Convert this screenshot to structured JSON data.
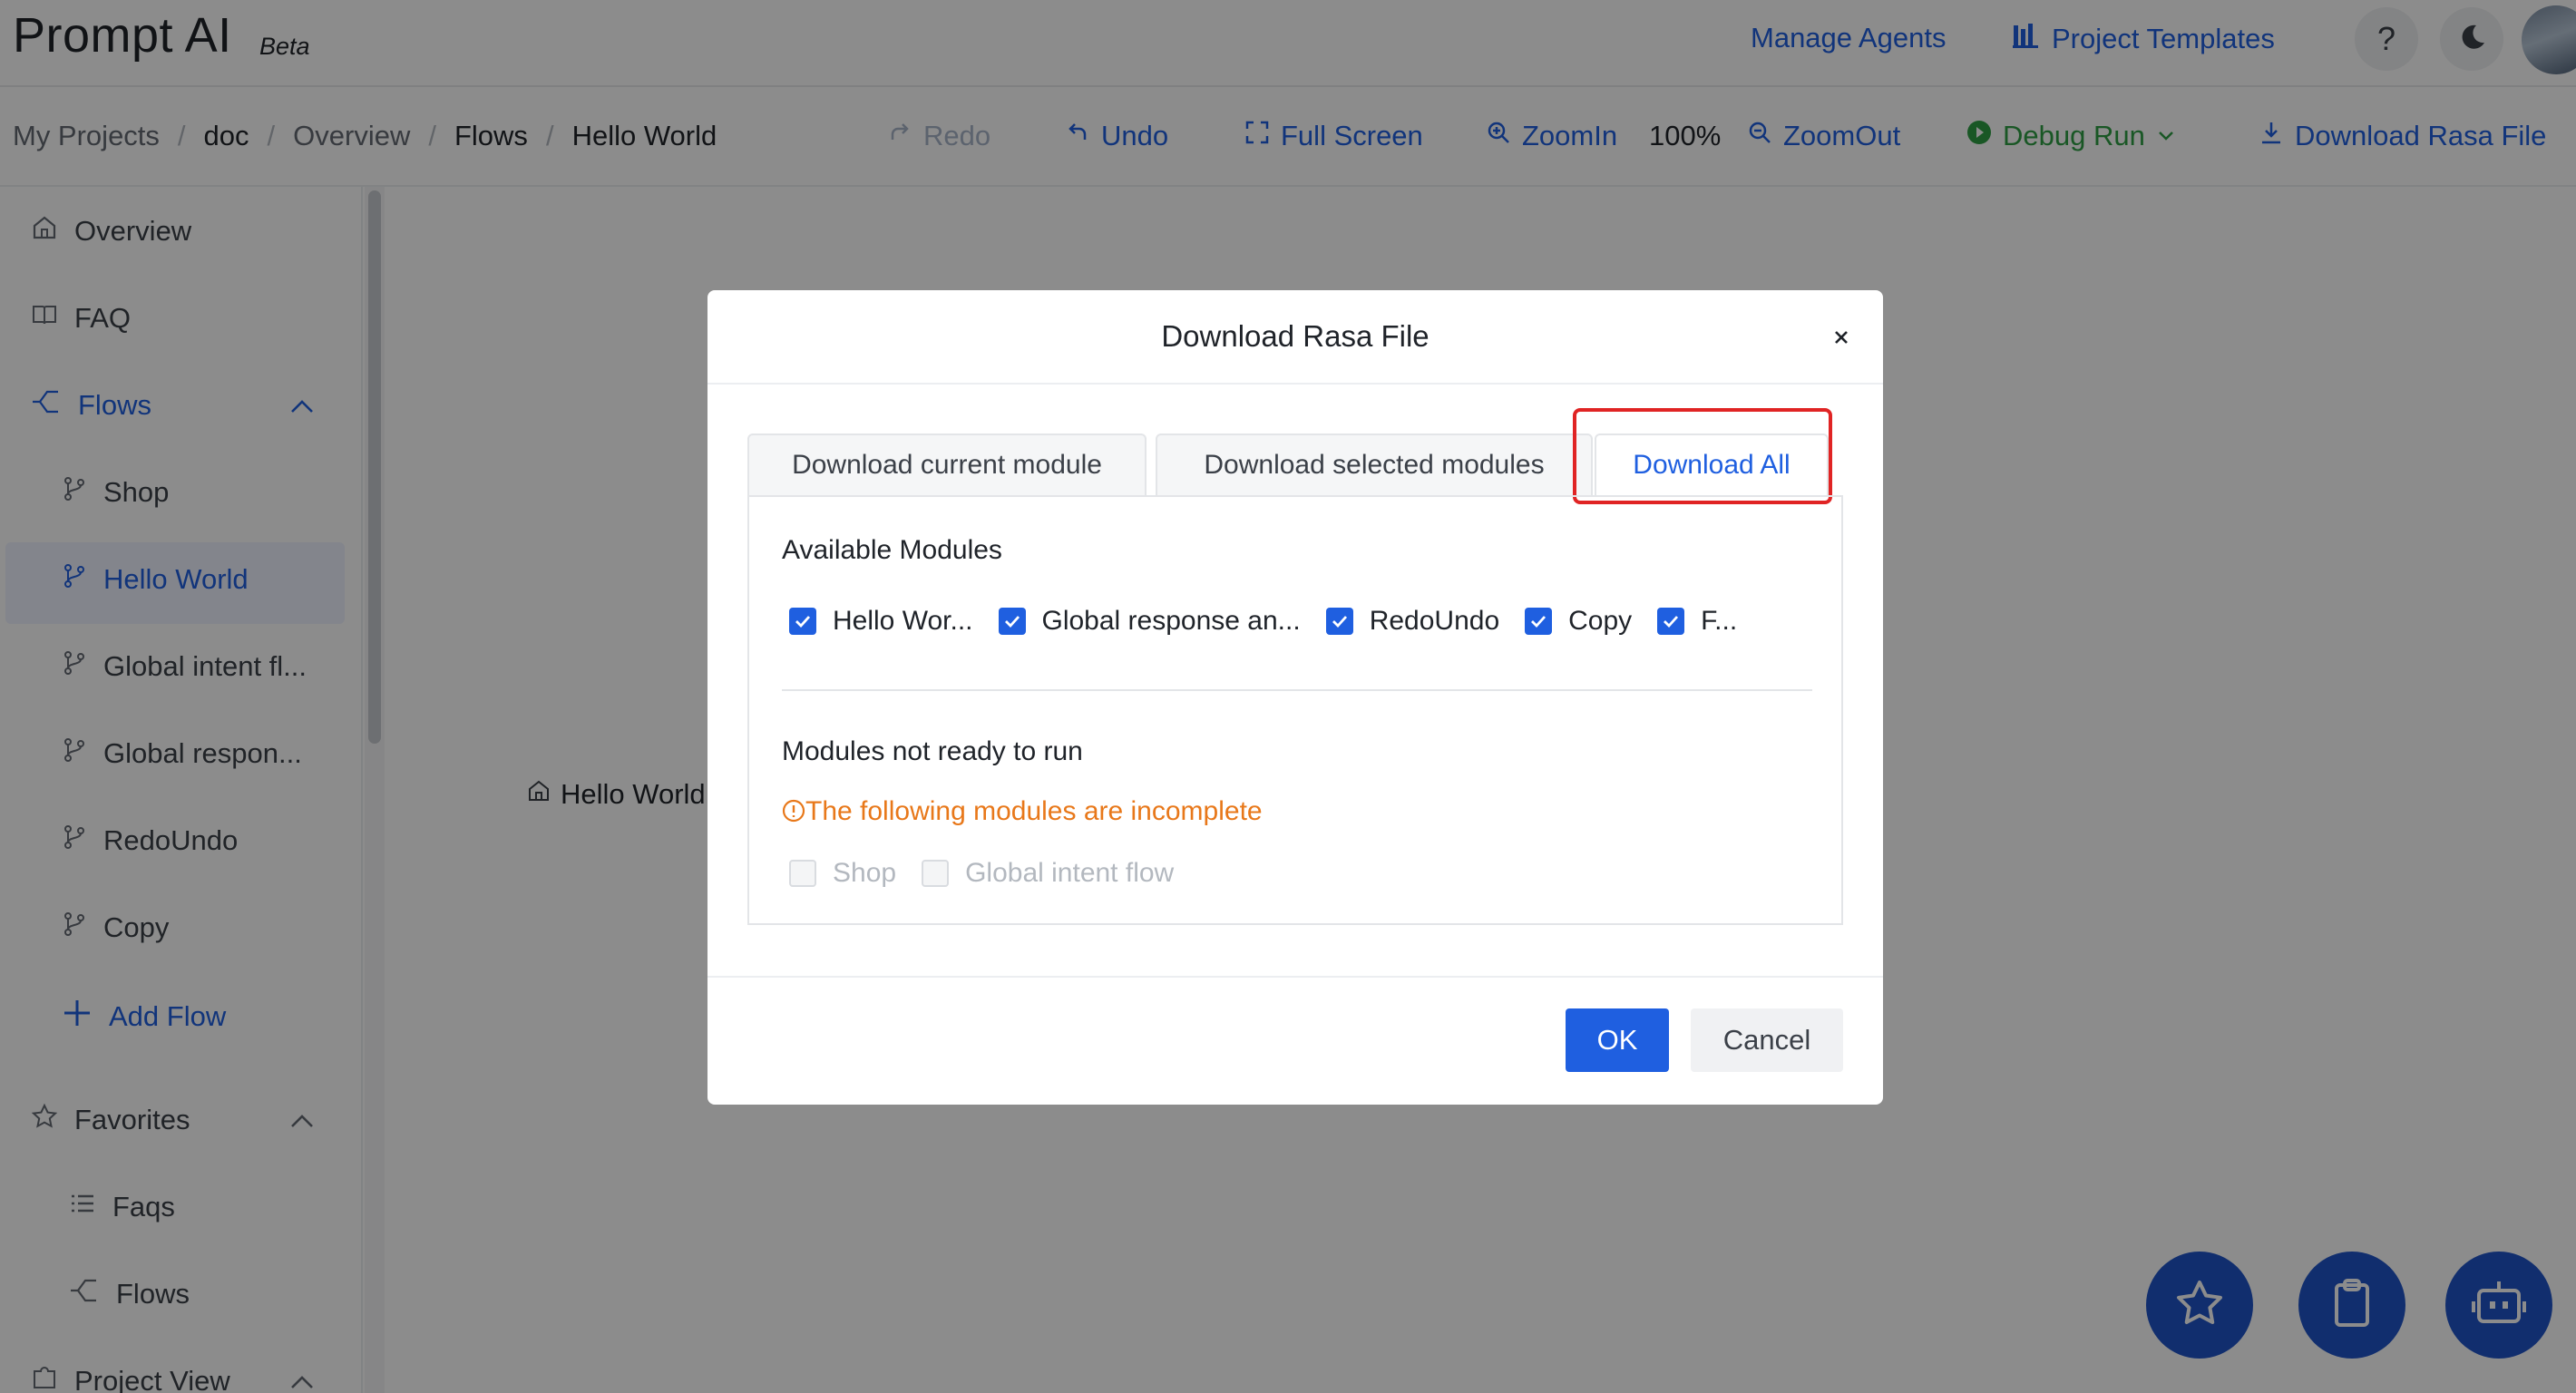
{
  "header": {
    "logo": "Prompt AI",
    "badge": "Beta",
    "manage_agents": "Manage Agents",
    "project_templates": "Project Templates",
    "help_icon": "help-icon",
    "theme_icon": "moon-icon"
  },
  "breadcrumb": {
    "items": [
      "My Projects",
      "doc",
      "Overview",
      "Flows",
      "Hello World"
    ],
    "separator": "/"
  },
  "toolbar": {
    "redo": "Redo",
    "undo": "Undo",
    "fullscreen": "Full Screen",
    "zoom_in": "ZoomIn",
    "zoom_level": "100%",
    "zoom_out": "ZoomOut",
    "debug_run": "Debug Run",
    "download": "Download Rasa File"
  },
  "sidebar": {
    "overview": "Overview",
    "faq": "FAQ",
    "flows": "Flows",
    "flow_items": [
      "Shop",
      "Hello World",
      "Global intent fl...",
      "Global respon...",
      "RedoUndo",
      "Copy"
    ],
    "active_flow": "Hello World",
    "add_flow": "Add Flow",
    "favorites": "Favorites",
    "favorite_items": [
      "Faqs",
      "Flows"
    ],
    "project_view": "Project View"
  },
  "canvas": {
    "node_label": "Hello World"
  },
  "modal": {
    "title": "Download Rasa File",
    "tabs": [
      "Download current module",
      "Download selected modules",
      "Download All"
    ],
    "active_tab": "Download All",
    "available_title": "Available Modules",
    "available_modules": [
      "Hello Wor...",
      "Global response an...",
      "RedoUndo",
      "Copy",
      "F..."
    ],
    "not_ready_title": "Modules not ready to run",
    "warning": "The following modules are incomplete",
    "incomplete_modules": [
      "Shop",
      "Global intent flow"
    ],
    "ok": "OK",
    "cancel": "Cancel"
  },
  "colors": {
    "accent": "#1f5fe0",
    "warning": "#e8781a",
    "highlight": "#e02424",
    "debug": "#2f9e44",
    "fab": "#1f54c9"
  }
}
